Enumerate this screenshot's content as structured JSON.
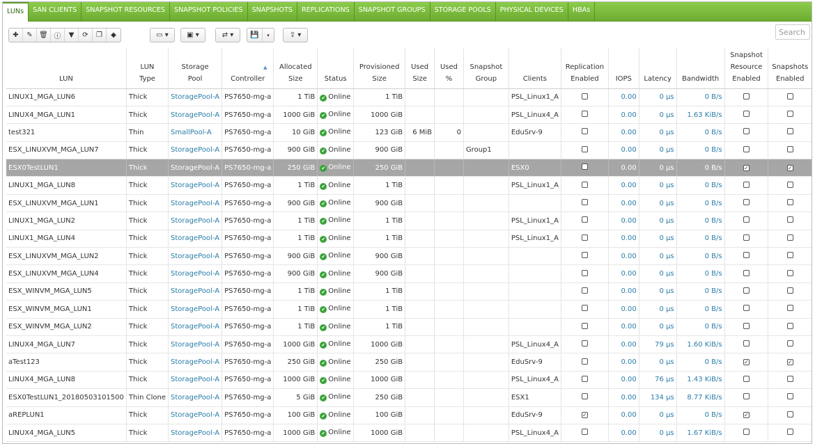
{
  "tabs": [
    "LUNs",
    "SAN CLIENTS",
    "SNAPSHOT RESOURCES",
    "SNAPSHOT POLICIES",
    "SNAPSHOTS",
    "REPLICATIONS",
    "SNAPSHOT GROUPS",
    "STORAGE POOLS",
    "PHYSICAL DEVICES",
    "HBAs"
  ],
  "active_tab": "LUNs",
  "toolbar_icons": [
    "add-icon",
    "edit-icon",
    "delete-icon",
    "info-icon",
    "filter-icon",
    "refresh-icon",
    "copy-icon",
    "tag-icon",
    "monitor-icon",
    "image-icon",
    "swap-icon",
    "save-icon",
    "export-icon"
  ],
  "search": {
    "placeholder": "Search"
  },
  "columns": [
    {
      "key": "lun",
      "lines": [
        "LUN"
      ]
    },
    {
      "key": "type",
      "lines": [
        "LUN",
        "Type"
      ]
    },
    {
      "key": "pool",
      "lines": [
        "Storage",
        "Pool"
      ]
    },
    {
      "key": "controller",
      "lines": [
        "Controller"
      ]
    },
    {
      "key": "alloc",
      "lines": [
        "Allocated",
        "Size"
      ]
    },
    {
      "key": "status",
      "lines": [
        "Status"
      ]
    },
    {
      "key": "prov",
      "lines": [
        "Provisioned",
        "Size"
      ]
    },
    {
      "key": "used",
      "lines": [
        "Used",
        "Size"
      ]
    },
    {
      "key": "usedpct",
      "lines": [
        "Used",
        "%"
      ]
    },
    {
      "key": "group",
      "lines": [
        "Snapshot",
        "Group"
      ]
    },
    {
      "key": "clients",
      "lines": [
        "Clients"
      ]
    },
    {
      "key": "repl",
      "lines": [
        "Replication",
        "Enabled"
      ]
    },
    {
      "key": "iops",
      "lines": [
        "IOPS"
      ]
    },
    {
      "key": "lat",
      "lines": [
        "Latency"
      ]
    },
    {
      "key": "bw",
      "lines": [
        "Bandwidth"
      ]
    },
    {
      "key": "snapres",
      "lines": [
        "Snapshot",
        "Resource",
        "Enabled"
      ]
    },
    {
      "key": "snapen",
      "lines": [
        "Snapshots",
        "Enabled"
      ]
    }
  ],
  "status_label": "Online",
  "rows": [
    {
      "lun": "LINUX1_MGA_LUN6",
      "type": "Thick",
      "pool": "StoragePool-A",
      "controller": "PS7650-mg-a",
      "alloc": "1 TiB",
      "prov": "1 TiB",
      "used": "",
      "usedpct": "",
      "group": "",
      "clients": "PSL_Linux1_A",
      "repl": false,
      "iops": "0.00",
      "lat": "0 µs",
      "bw": "0 B/s",
      "snapres": false,
      "snapen": false
    },
    {
      "lun": "LINUX4_MGA_LUN1",
      "type": "Thick",
      "pool": "StoragePool-A",
      "controller": "PS7650-mg-a",
      "alloc": "1000 GiB",
      "prov": "1000 GiB",
      "used": "",
      "usedpct": "",
      "group": "",
      "clients": "PSL_Linux4_A",
      "repl": false,
      "iops": "0.00",
      "lat": "0 µs",
      "bw": "1.63 KiB/s",
      "snapres": false,
      "snapen": false
    },
    {
      "lun": "test321",
      "type": "Thin",
      "pool": "SmallPool-A",
      "controller": "PS7650-mg-a",
      "alloc": "10 GiB",
      "prov": "123 GiB",
      "used": "6 MiB",
      "usedpct": "0",
      "group": "",
      "clients": "EduSrv-9",
      "repl": false,
      "iops": "0.00",
      "lat": "0 µs",
      "bw": "0 B/s",
      "snapres": false,
      "snapen": false
    },
    {
      "lun": "ESX_LINUXVM_MGA_LUN7",
      "type": "Thick",
      "pool": "StoragePool-A",
      "controller": "PS7650-mg-a",
      "alloc": "900 GiB",
      "prov": "900 GiB",
      "used": "",
      "usedpct": "",
      "group": "Group1",
      "clients": "",
      "repl": false,
      "iops": "0.00",
      "lat": "0 µs",
      "bw": "0 B/s",
      "snapres": false,
      "snapen": false
    },
    {
      "lun": "ESX0TestLUN1",
      "type": "Thick",
      "pool": "StoragePool-A",
      "controller": "PS7650-mg-a",
      "alloc": "250 GiB",
      "prov": "250 GiB",
      "used": "",
      "usedpct": "",
      "group": "",
      "clients": "ESX0",
      "repl": false,
      "iops": "0.00",
      "lat": "0 µs",
      "bw": "0 B/s",
      "snapres": true,
      "snapen": true,
      "selected": true
    },
    {
      "lun": "LINUX1_MGA_LUN8",
      "type": "Thick",
      "pool": "StoragePool-A",
      "controller": "PS7650-mg-a",
      "alloc": "1 TiB",
      "prov": "1 TiB",
      "used": "",
      "usedpct": "",
      "group": "",
      "clients": "PSL_Linux1_A",
      "repl": false,
      "iops": "0.00",
      "lat": "0 µs",
      "bw": "0 B/s",
      "snapres": false,
      "snapen": false
    },
    {
      "lun": "ESX_LINUXVM_MGA_LUN1",
      "type": "Thick",
      "pool": "StoragePool-A",
      "controller": "PS7650-mg-a",
      "alloc": "900 GiB",
      "prov": "900 GiB",
      "used": "",
      "usedpct": "",
      "group": "",
      "clients": "",
      "repl": false,
      "iops": "0.00",
      "lat": "0 µs",
      "bw": "0 B/s",
      "snapres": false,
      "snapen": false
    },
    {
      "lun": "LINUX1_MGA_LUN2",
      "type": "Thick",
      "pool": "StoragePool-A",
      "controller": "PS7650-mg-a",
      "alloc": "1 TiB",
      "prov": "1 TiB",
      "used": "",
      "usedpct": "",
      "group": "",
      "clients": "PSL_Linux1_A",
      "repl": false,
      "iops": "0.00",
      "lat": "0 µs",
      "bw": "0 B/s",
      "snapres": false,
      "snapen": false
    },
    {
      "lun": "LINUX1_MGA_LUN4",
      "type": "Thick",
      "pool": "StoragePool-A",
      "controller": "PS7650-mg-a",
      "alloc": "1 TiB",
      "prov": "1 TiB",
      "used": "",
      "usedpct": "",
      "group": "",
      "clients": "PSL_Linux1_A",
      "repl": false,
      "iops": "0.00",
      "lat": "0 µs",
      "bw": "0 B/s",
      "snapres": false,
      "snapen": false
    },
    {
      "lun": "ESX_LINUXVM_MGA_LUN2",
      "type": "Thick",
      "pool": "StoragePool-A",
      "controller": "PS7650-mg-a",
      "alloc": "900 GiB",
      "prov": "900 GiB",
      "used": "",
      "usedpct": "",
      "group": "",
      "clients": "",
      "repl": false,
      "iops": "0.00",
      "lat": "0 µs",
      "bw": "0 B/s",
      "snapres": false,
      "snapen": false
    },
    {
      "lun": "ESX_LINUXVM_MGA_LUN4",
      "type": "Thick",
      "pool": "StoragePool-A",
      "controller": "PS7650-mg-a",
      "alloc": "900 GiB",
      "prov": "900 GiB",
      "used": "",
      "usedpct": "",
      "group": "",
      "clients": "",
      "repl": false,
      "iops": "0.00",
      "lat": "0 µs",
      "bw": "0 B/s",
      "snapres": false,
      "snapen": false
    },
    {
      "lun": "ESX_WINVM_MGA_LUN5",
      "type": "Thick",
      "pool": "StoragePool-A",
      "controller": "PS7650-mg-a",
      "alloc": "1 TiB",
      "prov": "1 TiB",
      "used": "",
      "usedpct": "",
      "group": "",
      "clients": "",
      "repl": false,
      "iops": "0.00",
      "lat": "0 µs",
      "bw": "0 B/s",
      "snapres": false,
      "snapen": false
    },
    {
      "lun": "ESX_WINVM_MGA_LUN1",
      "type": "Thick",
      "pool": "StoragePool-A",
      "controller": "PS7650-mg-a",
      "alloc": "1 TiB",
      "prov": "1 TiB",
      "used": "",
      "usedpct": "",
      "group": "",
      "clients": "",
      "repl": false,
      "iops": "0.00",
      "lat": "0 µs",
      "bw": "0 B/s",
      "snapres": false,
      "snapen": false
    },
    {
      "lun": "ESX_WINVM_MGA_LUN2",
      "type": "Thick",
      "pool": "StoragePool-A",
      "controller": "PS7650-mg-a",
      "alloc": "1 TiB",
      "prov": "1 TiB",
      "used": "",
      "usedpct": "",
      "group": "",
      "clients": "",
      "repl": false,
      "iops": "0.00",
      "lat": "0 µs",
      "bw": "0 B/s",
      "snapres": false,
      "snapen": false
    },
    {
      "lun": "LINUX4_MGA_LUN7",
      "type": "Thick",
      "pool": "StoragePool-A",
      "controller": "PS7650-mg-a",
      "alloc": "1000 GiB",
      "prov": "1000 GiB",
      "used": "",
      "usedpct": "",
      "group": "",
      "clients": "PSL_Linux4_A",
      "repl": false,
      "iops": "0.00",
      "lat": "79 µs",
      "bw": "1.60 KiB/s",
      "snapres": false,
      "snapen": false
    },
    {
      "lun": "aTest123",
      "type": "Thick",
      "pool": "StoragePool-A",
      "controller": "PS7650-mg-a",
      "alloc": "250 GiB",
      "prov": "250 GiB",
      "used": "",
      "usedpct": "",
      "group": "",
      "clients": "EduSrv-9",
      "repl": false,
      "iops": "0.00",
      "lat": "0 µs",
      "bw": "0 B/s",
      "snapres": true,
      "snapen": true
    },
    {
      "lun": "LINUX4_MGA_LUN8",
      "type": "Thick",
      "pool": "StoragePool-A",
      "controller": "PS7650-mg-a",
      "alloc": "1000 GiB",
      "prov": "1000 GiB",
      "used": "",
      "usedpct": "",
      "group": "",
      "clients": "PSL_Linux4_A",
      "repl": false,
      "iops": "0.00",
      "lat": "76 µs",
      "bw": "1.43 KiB/s",
      "snapres": false,
      "snapen": false
    },
    {
      "lun": "ESX0TestLUN1_20180503101500",
      "type": "Thin Clone",
      "pool": "StoragePool-A",
      "controller": "PS7650-mg-a",
      "alloc": "5 GiB",
      "prov": "250 GiB",
      "used": "",
      "usedpct": "",
      "group": "",
      "clients": "ESX1",
      "repl": false,
      "iops": "0.00",
      "lat": "134 µs",
      "bw": "8.77 KiB/s",
      "snapres": false,
      "snapen": false
    },
    {
      "lun": "aREPLUN1",
      "type": "Thick",
      "pool": "StoragePool-A",
      "controller": "PS7650-mg-a",
      "alloc": "100 GiB",
      "prov": "100 GiB",
      "used": "",
      "usedpct": "",
      "group": "",
      "clients": "EduSrv-9",
      "repl": true,
      "iops": "0.00",
      "lat": "0 µs",
      "bw": "0 B/s",
      "snapres": true,
      "snapen": false
    },
    {
      "lun": "LINUX4_MGA_LUN5",
      "type": "Thick",
      "pool": "StoragePool-A",
      "controller": "PS7650-mg-a",
      "alloc": "1000 GiB",
      "prov": "1000 GiB",
      "used": "",
      "usedpct": "",
      "group": "",
      "clients": "PSL_Linux4_A",
      "repl": false,
      "iops": "0.00",
      "lat": "0 µs",
      "bw": "1.67 KiB/s",
      "snapres": false,
      "snapen": false
    }
  ]
}
